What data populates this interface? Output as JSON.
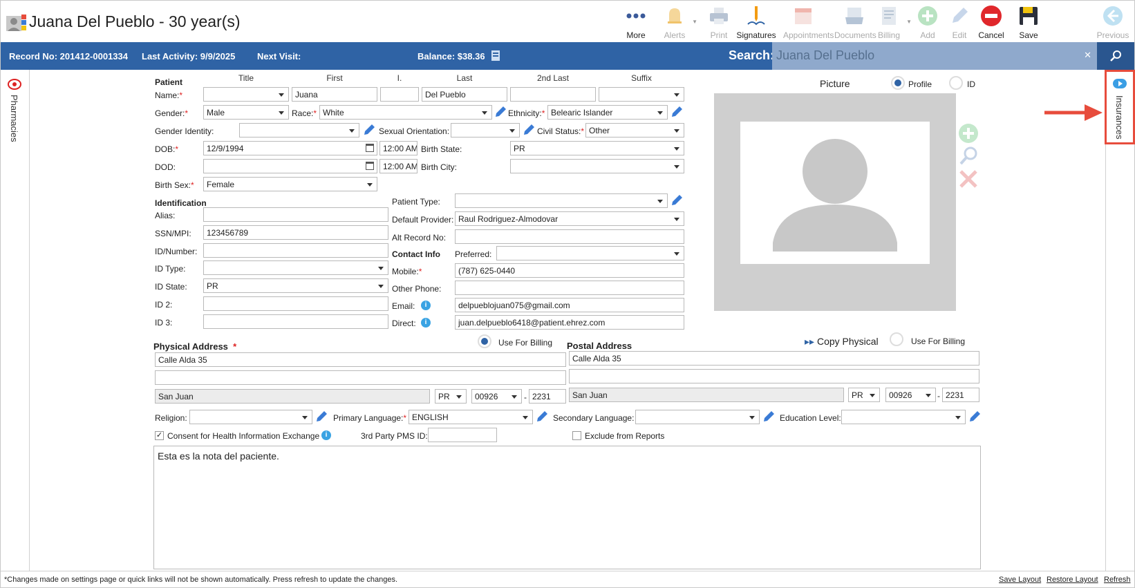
{
  "header": {
    "title": "Juana Del Pueblo - 30 year(s)"
  },
  "toolbar": [
    {
      "name": "more",
      "label": "More",
      "enabled": true
    },
    {
      "name": "alerts",
      "label": "Alerts",
      "enabled": false
    },
    {
      "name": "print",
      "label": "Print",
      "enabled": false
    },
    {
      "name": "signatures",
      "label": "Signatures",
      "enabled": true
    },
    {
      "name": "appointments",
      "label": "Appointments",
      "enabled": false
    },
    {
      "name": "documents",
      "label": "Documents",
      "enabled": false
    },
    {
      "name": "billing",
      "label": "Billing",
      "enabled": false
    },
    {
      "name": "add",
      "label": "Add",
      "enabled": false
    },
    {
      "name": "edit",
      "label": "Edit",
      "enabled": false
    },
    {
      "name": "cancel",
      "label": "Cancel",
      "enabled": true
    },
    {
      "name": "save",
      "label": "Save",
      "enabled": true
    },
    {
      "name": "previous",
      "label": "Previous",
      "enabled": false
    }
  ],
  "infobar": {
    "record": "Record No: 201412-0001334",
    "last_activity": "Last Activity: 9/9/2025",
    "next_visit": "Next Visit:",
    "balance": "Balance: $38.36",
    "search_label": "Search:",
    "search_value": "Juana Del Pueblo"
  },
  "side": {
    "left": "Pharmacies",
    "right": "Insurances"
  },
  "patient": {
    "section": "Patient",
    "cols": {
      "title": "Title",
      "first": "First",
      "initial": "I.",
      "last": "Last",
      "last2": "2nd Last",
      "suffix": "Suffix"
    },
    "labels": {
      "name": "Name:",
      "gender": "Gender:",
      "race": "Race:",
      "ethnicity": "Ethnicity:",
      "gender_identity": "Gender Identity:",
      "sexual_orientation": "Sexual Orientation:",
      "civil_status": "Civil Status:",
      "dob": "DOB:",
      "birth_state": "Birth State:",
      "dod": "DOD:",
      "birth_city": "Birth City:",
      "birth_sex": "Birth Sex:"
    },
    "values": {
      "title": "",
      "first": "Juana",
      "initial": "",
      "last": "Del Pueblo",
      "last2": "",
      "suffix": "",
      "gender": "Male",
      "race": "White",
      "ethnicity": "Belearic Islander",
      "gender_identity": "",
      "sexual_orientation": "",
      "civil_status": "Other",
      "dob": "12/9/1994",
      "dob_time": "12:00 AM",
      "birth_state": "PR",
      "dod": "",
      "dod_time": "12:00 AM",
      "birth_city": "",
      "birth_sex": "Female"
    }
  },
  "identification": {
    "section": "Identification",
    "labels": {
      "alias": "Alias:",
      "ssn": "SSN/MPI:",
      "id_number": "ID/Number:",
      "id_type": "ID Type:",
      "id_state": "ID State:",
      "id2": "ID 2:",
      "id3": "ID 3:",
      "patient_type": "Patient Type:",
      "default_provider": "Default Provider:",
      "alt_record": "Alt Record No:"
    },
    "values": {
      "alias": "",
      "ssn": "123456789",
      "id_number": "",
      "id_type": "",
      "id_state": "PR",
      "id2": "",
      "id3": "",
      "patient_type": "",
      "default_provider": "Raul Rodriguez-Almodovar",
      "alt_record": ""
    }
  },
  "contact": {
    "section": "Contact Info",
    "labels": {
      "preferred": "Preferred:",
      "mobile": "Mobile:",
      "other_phone": "Other Phone:",
      "email": "Email:",
      "direct": "Direct:"
    },
    "values": {
      "preferred": "",
      "mobile": "(787) 625-0440",
      "other_phone": "",
      "email": "delpueblojuan075@gmail.com",
      "direct": "juan.delpueblo6418@patient.ehrez.com"
    }
  },
  "picture": {
    "label": "Picture",
    "profile": "Profile",
    "id": "ID"
  },
  "physical": {
    "section": "Physical Address",
    "use_billing": "Use For Billing",
    "line1": "Calle Alda 35",
    "line2": "",
    "city": "San Juan",
    "state": "PR",
    "zip": "00926",
    "zip4": "2231"
  },
  "postal": {
    "section": "Postal Address",
    "copy": "Copy Physical",
    "use_billing": "Use For Billing",
    "line1": "Calle Alda 35",
    "line2": "",
    "city": "San Juan",
    "state": "PR",
    "zip": "00926",
    "zip4": "2231"
  },
  "misc": {
    "religion": "Religion:",
    "religion_val": "",
    "primary_language": "Primary Language:",
    "primary_language_val": "ENGLISH",
    "secondary_language": "Secondary Language:",
    "secondary_language_val": "",
    "education": "Education Level:",
    "education_val": "",
    "consent": "Consent for Health Information Exchange",
    "pms": "3rd Party PMS ID:",
    "pms_val": "",
    "exclude": "Exclude from Reports"
  },
  "note": "Esta es la nota del paciente.",
  "footer": {
    "msg": "*Changes made on settings page or quick links will not be shown automatically. Press refresh to update the changes.",
    "save_layout": "Save Layout",
    "restore_layout": "Restore Layout",
    "refresh": "Refresh"
  }
}
